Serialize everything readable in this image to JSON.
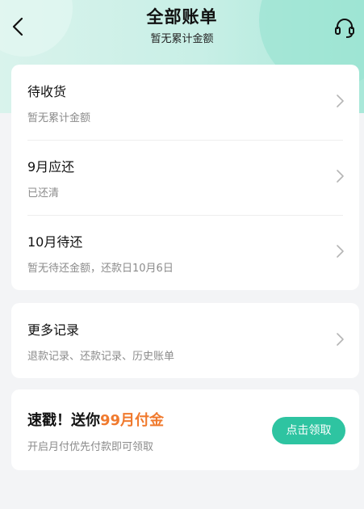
{
  "header": {
    "title": "全部账单",
    "subtitle": "暂无累计金额",
    "back_icon": "chevron-left-icon",
    "support_icon": "headset-icon"
  },
  "bills": [
    {
      "title": "待收货",
      "subtitle": "暂无累计金额"
    },
    {
      "title": "9月应还",
      "subtitle": "已还清"
    },
    {
      "title": "10月待还",
      "subtitle": "暂无待还金额，还款日10月6日"
    }
  ],
  "more": {
    "title": "更多记录",
    "subtitle": "退款记录、还款记录、历史账单"
  },
  "promo": {
    "title_prefix": "速戳！送你",
    "title_highlight": "99月付金",
    "subtitle": "开启月付优先付款即可领取",
    "button_label": "点击领取"
  },
  "colors": {
    "accent": "#2ec4a1",
    "highlight": "#f07a2e",
    "header_gradient": [
      "#d9f3ec",
      "#a9e8d9"
    ]
  }
}
